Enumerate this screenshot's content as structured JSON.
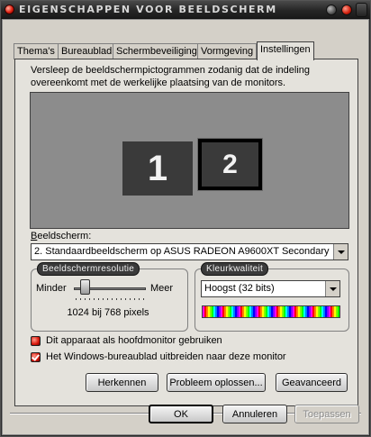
{
  "window": {
    "title": "Eigenschappen voor beeldscherm"
  },
  "tabs": [
    {
      "label": "Thema's"
    },
    {
      "label": "Bureaublad"
    },
    {
      "label": "Schermbeveiliging"
    },
    {
      "label": "Vormgeving"
    },
    {
      "label": "Instellingen",
      "active": true
    }
  ],
  "settings": {
    "instructions": "Versleep de beeldschermpictogrammen zodanig dat de indeling overeenkomt met de werkelijke plaatsing van de monitors.",
    "monitors": [
      {
        "number": "1",
        "selected": false
      },
      {
        "number": "2",
        "selected": true
      }
    ],
    "display_label": "Beeldscherm:",
    "display_value": "2. Standaardbeeldscherm op ASUS RADEON A9600XT Secondary",
    "resolution": {
      "group_label": "Beeldschermresolutie",
      "min_label": "Minder",
      "max_label": "Meer",
      "value_text": "1024 bij 768 pixels"
    },
    "color_quality": {
      "group_label": "Kleurkwaliteit",
      "value": "Hoogst (32 bits)"
    },
    "checkboxes": [
      {
        "label": "Dit apparaat als hoofdmonitor gebruiken",
        "checked": false
      },
      {
        "label": "Het Windows-bureaublad uitbreiden naar deze monitor",
        "checked": true
      }
    ],
    "buttons": {
      "identify": "Herkennen",
      "troubleshoot": "Probleem oplossen...",
      "advanced": "Geavanceerd"
    }
  },
  "dialog_buttons": {
    "ok": "OK",
    "cancel": "Annuleren",
    "apply": "Toepassen"
  },
  "colors": {
    "titlebar": "#262626",
    "dialog_bg": "#d4d0c8",
    "monitor_area": "#8c8c8c",
    "accent_red": "#d8160a"
  }
}
